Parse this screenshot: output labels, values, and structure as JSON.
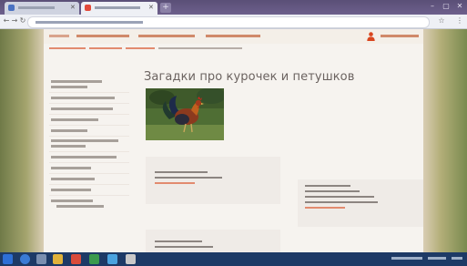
{
  "page": {
    "title": "Загадки про курочек и петушков"
  },
  "colors": {
    "accent": "#e28b6f",
    "title_text": "#6b6360",
    "taskbar": "#1d3a66"
  },
  "icons": [
    "browser-tab-favicon",
    "close-icon",
    "new-tab-icon",
    "back-icon",
    "forward-icon",
    "reload-icon",
    "star-icon",
    "menu-icon",
    "user-icon",
    "start-icon",
    "taskbar-app-icon"
  ]
}
